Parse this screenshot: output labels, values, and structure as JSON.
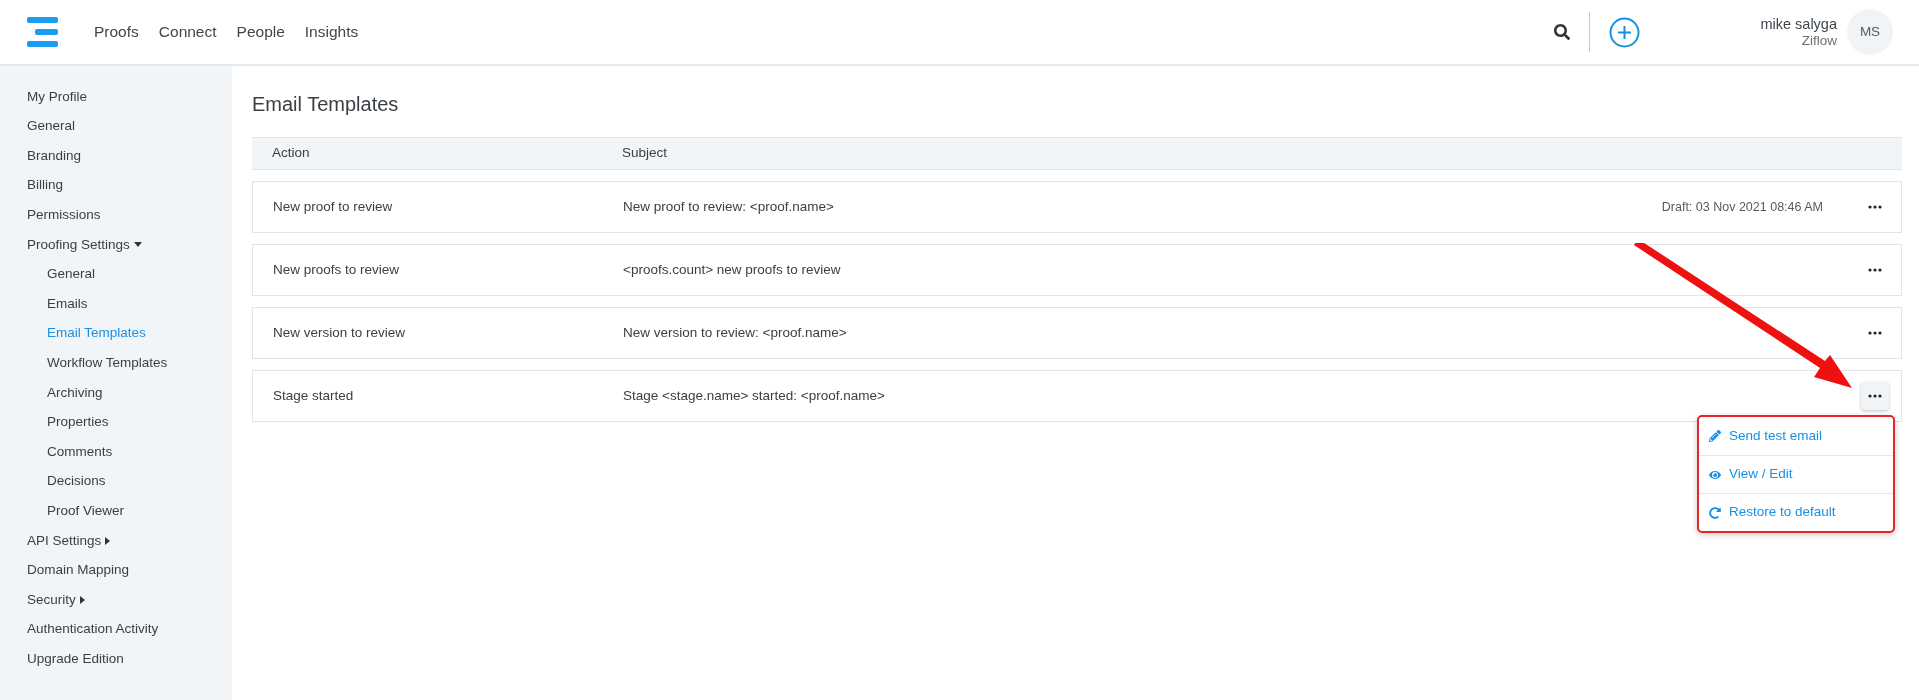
{
  "nav": [
    {
      "label": "Proofs"
    },
    {
      "label": "Connect"
    },
    {
      "label": "People"
    },
    {
      "label": "Insights"
    }
  ],
  "user": {
    "name": "mike salyga",
    "company": "Ziflow",
    "initials": "MS"
  },
  "sidebar": {
    "items": [
      {
        "label": "My Profile",
        "selected": false
      },
      {
        "label": "General",
        "selected": false
      },
      {
        "label": "Branding",
        "selected": false
      },
      {
        "label": "Billing",
        "selected": false
      },
      {
        "label": "Permissions",
        "selected": false
      },
      {
        "label": "Proofing Settings",
        "selected": false,
        "expanded": true,
        "children": [
          {
            "label": "General",
            "selected": false
          },
          {
            "label": "Emails",
            "selected": false
          },
          {
            "label": "Email Templates",
            "selected": true
          },
          {
            "label": "Workflow Templates",
            "selected": false
          },
          {
            "label": "Archiving",
            "selected": false
          },
          {
            "label": "Properties",
            "selected": false
          },
          {
            "label": "Comments",
            "selected": false
          },
          {
            "label": "Decisions",
            "selected": false
          },
          {
            "label": "Proof Viewer",
            "selected": false
          }
        ]
      },
      {
        "label": "API Settings",
        "selected": false,
        "expanded": false
      },
      {
        "label": "Domain Mapping",
        "selected": false
      },
      {
        "label": "Security",
        "selected": false,
        "expanded": false
      },
      {
        "label": "Authentication Activity",
        "selected": false
      },
      {
        "label": "Upgrade Edition",
        "selected": false
      }
    ]
  },
  "page_title": "Email Templates",
  "table": {
    "columns": [
      "Action",
      "Subject"
    ],
    "rows": [
      {
        "action": "New proof to review",
        "subject": "New proof to review: <proof.name>",
        "draft": "Draft: 03 Nov 2021 08:46 AM",
        "menu_open": false
      },
      {
        "action": "New proofs to review",
        "subject": "<proofs.count> new proofs to review",
        "menu_open": false
      },
      {
        "action": "New version to review",
        "subject": "New version to review: <proof.name>",
        "menu_open": false
      },
      {
        "action": "Stage started",
        "subject": "Stage <stage.name> started: <proof.name>",
        "menu_open": true
      }
    ]
  },
  "row_menu": {
    "items": [
      {
        "kind": "pencil",
        "label": "Send test email"
      },
      {
        "kind": "eye",
        "label": "View / Edit"
      },
      {
        "kind": "restore",
        "label": "Restore to default"
      }
    ]
  }
}
